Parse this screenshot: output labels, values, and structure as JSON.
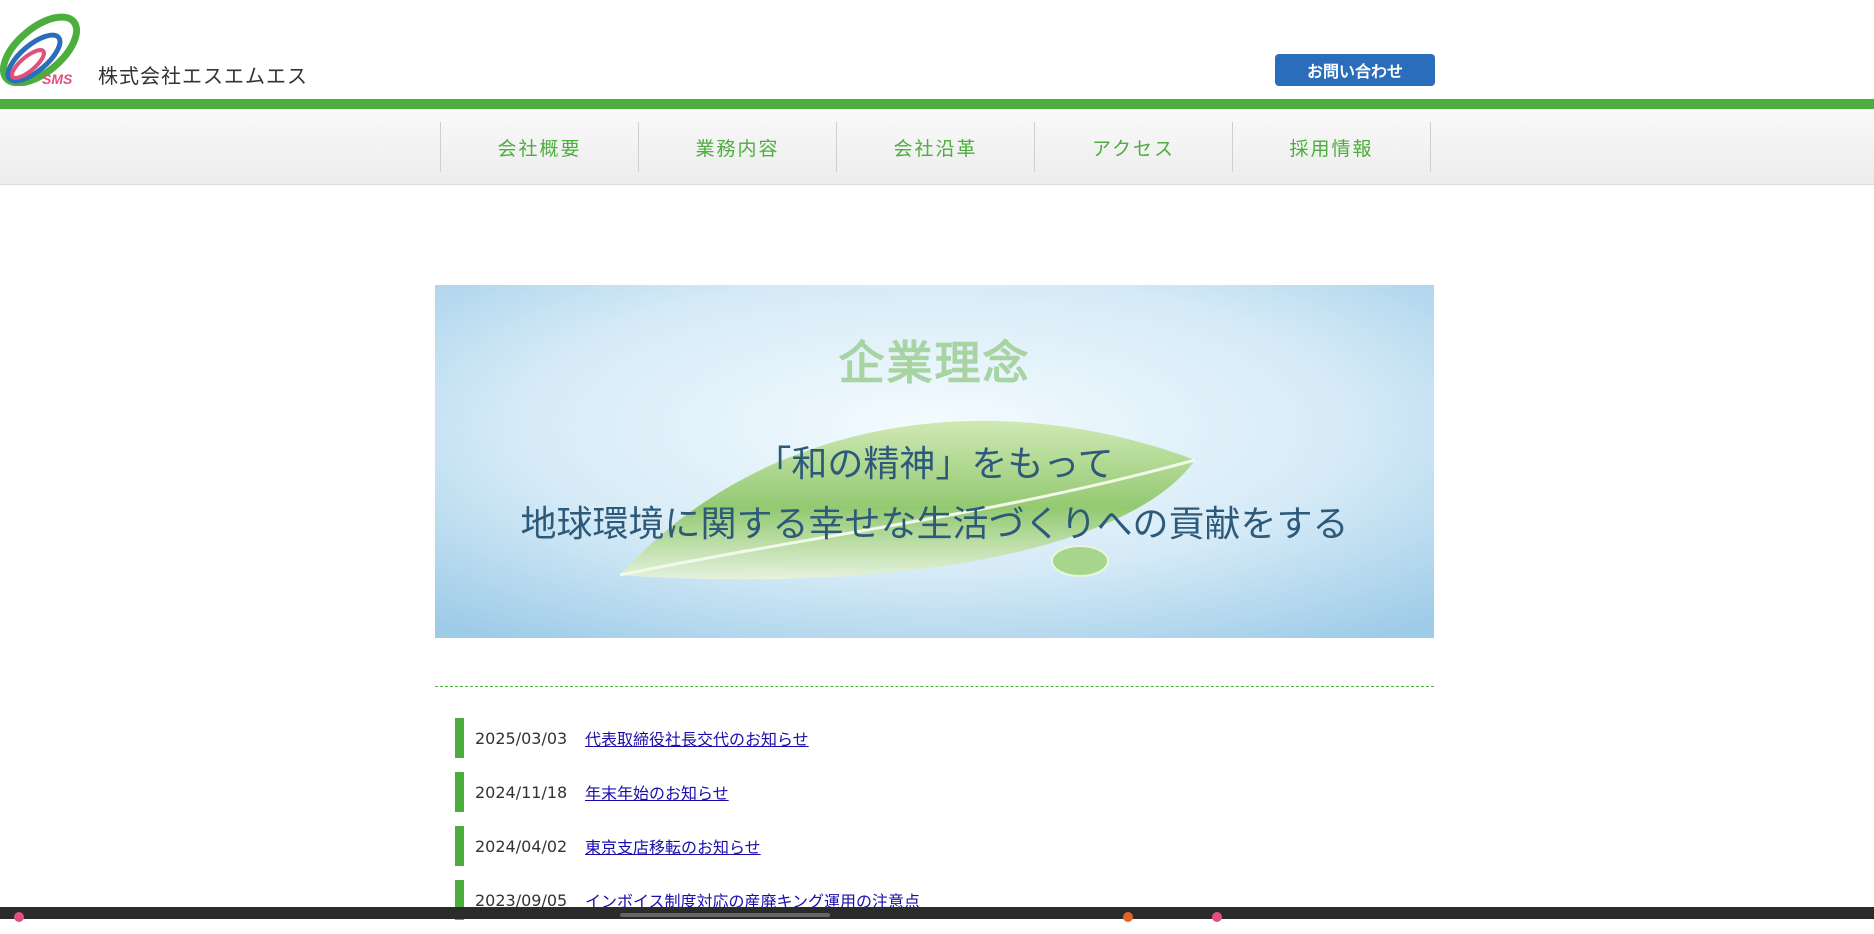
{
  "header": {
    "logo_text": "SMS",
    "company_name": "株式会社エスエムエス",
    "contact_label": "お問い合わせ"
  },
  "nav": {
    "items": [
      {
        "label": "会社概要"
      },
      {
        "label": "業務内容"
      },
      {
        "label": "会社沿革"
      },
      {
        "label": "アクセス"
      },
      {
        "label": "採用情報"
      }
    ]
  },
  "banner": {
    "title": "企業理念",
    "line1": "「和の精神」をもって",
    "line2": "地球環境に関する幸せな生活づくりへの貢献をする"
  },
  "news": {
    "items": [
      {
        "date": "2025/03/03",
        "title": "代表取締役社長交代のお知らせ"
      },
      {
        "date": "2024/11/18",
        "title": "年末年始のお知らせ"
      },
      {
        "date": "2024/04/02",
        "title": "東京支店移転のお知らせ"
      },
      {
        "date": "2023/09/05",
        "title": "インボイス制度対応の産廃キング運用の注意点"
      }
    ]
  },
  "colors": {
    "brand_green": "#4cae3c",
    "contact_blue": "#2a6ebb",
    "link_blue": "#1a0dab"
  }
}
